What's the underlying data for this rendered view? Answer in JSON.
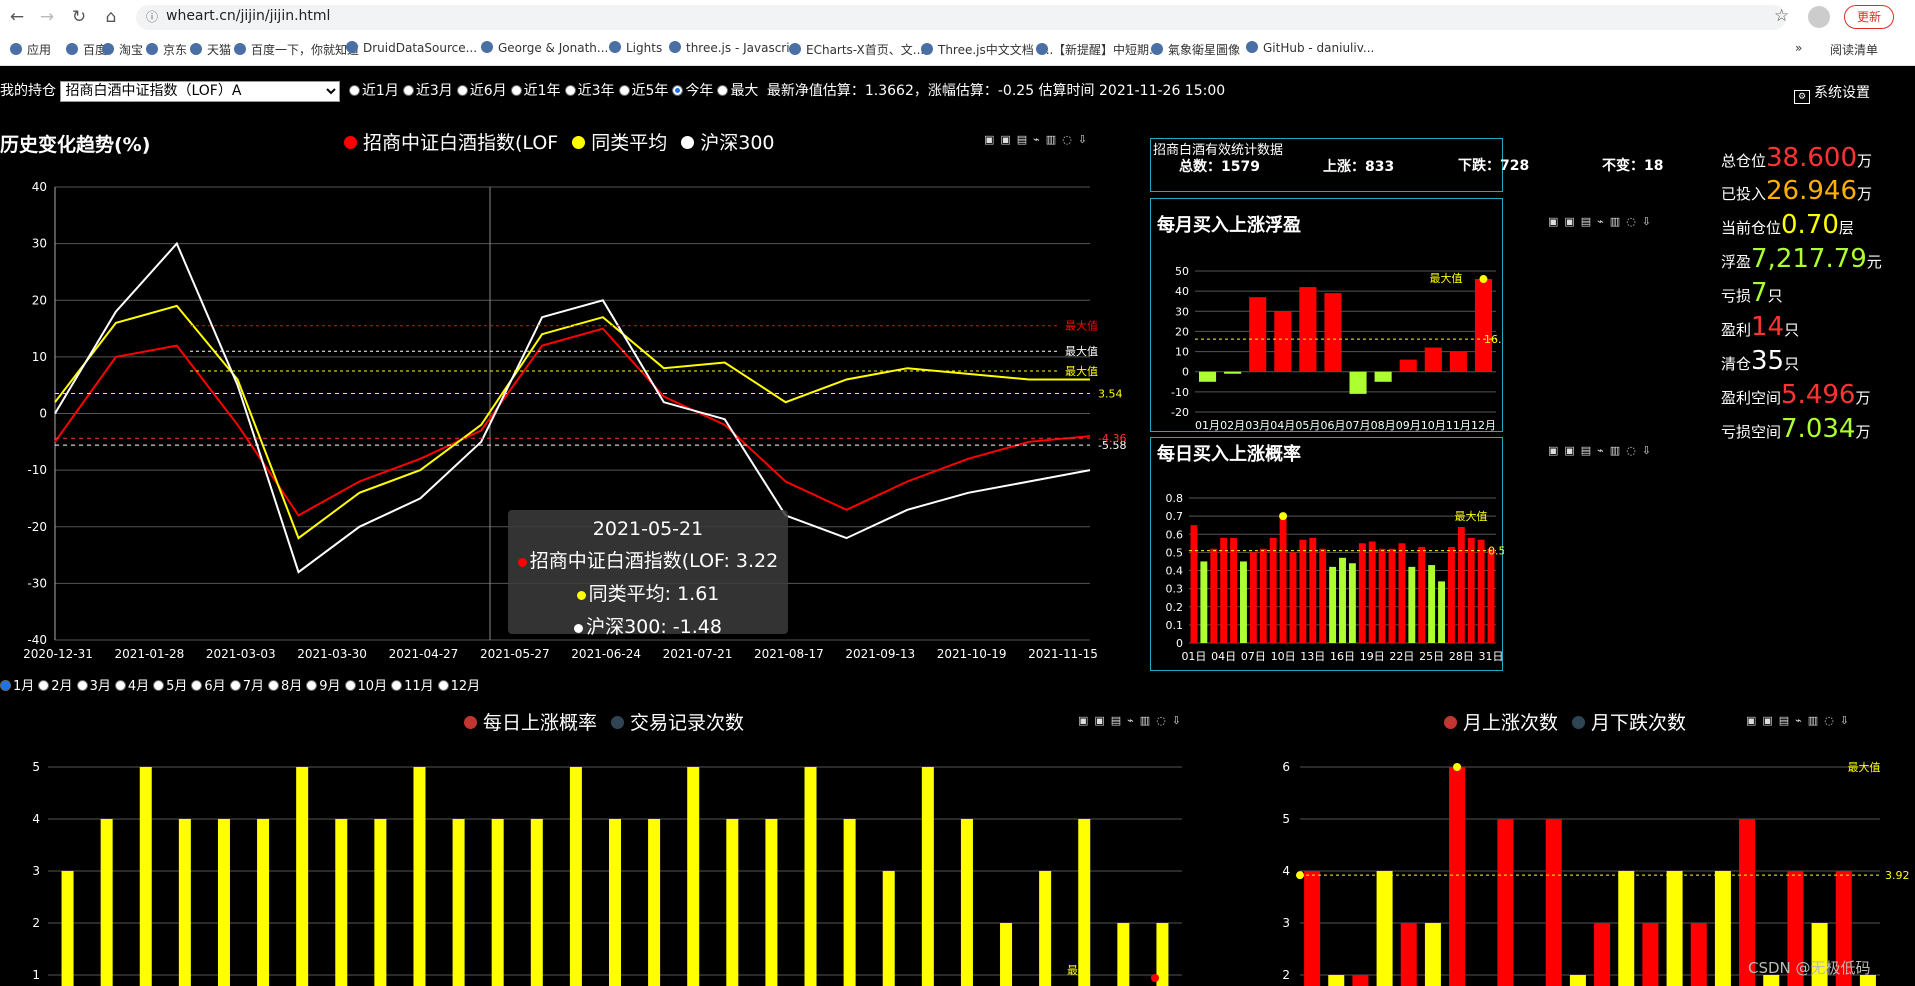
{
  "browser": {
    "url": "wheart.cn/jijin/jijin.html",
    "update_label": "更新",
    "bookmarks": [
      "应用",
      "百度",
      "淘宝",
      "京东",
      "天猫",
      "百度一下，你就知道",
      "DruidDataSource...",
      "George & Jonath...",
      "Lights",
      "three.js - Javascri...",
      "ECharts-X首页、文...",
      "Three.js中文文档 -...",
      "【新提醒】中短期...",
      "氣象衛星圖像",
      "GitHub - daniuliv..."
    ],
    "more": "»",
    "reading_list": "阅读清单"
  },
  "topbar": {
    "label": "我的持仓",
    "fund": "招商白酒中证指数（LOF）A",
    "ranges": [
      "近1月",
      "近3月",
      "近6月",
      "近1年",
      "近3年",
      "近5年",
      "今年",
      "最大"
    ],
    "selected": 6,
    "estimate": "最新净值估算：1.3662，涨幅估算：-0.25 估算时间 2021-11-26 15:00",
    "settings": "系统设置"
  },
  "trend": {
    "title": "历史变化趋势(%)",
    "legend": [
      {
        "name": "招商中证白酒指数(LOF",
        "color": "#ff0000"
      },
      {
        "name": "同类平均",
        "color": "#ffff00"
      },
      {
        "name": "沪深300",
        "color": "#ffffff"
      }
    ],
    "tooltip": {
      "date": "2021-05-21",
      "l1": "招商中证白酒指数(LOF: 3.22",
      "l2": "同类平均: 1.61",
      "l3": "沪深300: -1.48"
    },
    "marks": {
      "max": "最大值",
      "max2": "最大值",
      "max3": "最大值",
      "v1": "3.54",
      "v2": "-5.58",
      "v3": "-4.36"
    }
  },
  "chart_data": [
    {
      "type": "line",
      "title": "历史变化趋势(%)",
      "ylim": [
        -40,
        40
      ],
      "x": [
        "2020-12-31",
        "2021-01-28",
        "2021-03-03",
        "2021-03-30",
        "2021-04-27",
        "2021-05-27",
        "2021-06-24",
        "2021-07-21",
        "2021-08-17",
        "2021-09-13",
        "2021-10-19",
        "2021-11-15"
      ],
      "series": [
        {
          "name": "招商中证白酒指数(LOF",
          "values": [
            -5,
            10,
            12,
            -2,
            -18,
            -12,
            -8,
            -3,
            12,
            15,
            3,
            -2,
            -12,
            -17,
            -12,
            -8,
            -5,
            -4
          ]
        },
        {
          "name": "同类平均",
          "values": [
            2,
            16,
            19,
            6,
            -22,
            -14,
            -10,
            -2,
            14,
            17,
            8,
            9,
            2,
            6,
            8,
            7,
            6,
            6
          ]
        },
        {
          "name": "沪深300",
          "values": [
            0,
            18,
            30,
            5,
            -28,
            -20,
            -15,
            -5,
            17,
            20,
            2,
            -1,
            -18,
            -22,
            -17,
            -14,
            -12,
            -10
          ]
        }
      ]
    },
    {
      "type": "bar",
      "title": "每月买入上涨浮盈",
      "categories": [
        "01月",
        "02月",
        "03月",
        "04月",
        "05月",
        "06月",
        "07月",
        "08月",
        "09月",
        "10月",
        "11月",
        "12月"
      ],
      "values": [
        -5,
        -1,
        37,
        30,
        42,
        39,
        -11,
        -5,
        6,
        12,
        10,
        46
      ],
      "ylim": [
        -20,
        50
      ]
    },
    {
      "type": "bar",
      "title": "每日买入上涨概率",
      "categories": [
        "01日",
        "04日",
        "07日",
        "10日",
        "13日",
        "16日",
        "19日",
        "22日",
        "25日",
        "28日",
        "31日"
      ],
      "values": [
        0.65,
        0.45,
        0.52,
        0.58,
        0.58,
        0.45,
        0.5,
        0.52,
        0.58,
        0.7,
        0.5,
        0.57,
        0.58,
        0.52,
        0.42,
        0.47,
        0.44,
        0.55,
        0.56,
        0.52,
        0.52,
        0.55,
        0.42,
        0.53,
        0.43,
        0.34,
        0.53,
        0.64,
        0.58,
        0.57,
        0.52
      ],
      "ylim": [
        0,
        0.8
      ]
    },
    {
      "type": "bar",
      "title": "每日上涨概率",
      "series": [
        {
          "name": "每日上涨概率"
        },
        {
          "name": "交易记录次数"
        }
      ],
      "values": [
        3,
        4,
        5,
        4,
        4,
        4,
        5,
        4,
        4,
        5,
        4,
        4,
        4,
        5,
        4,
        4,
        5,
        4,
        4,
        5,
        4,
        3,
        5,
        4,
        2,
        3,
        4,
        2,
        2
      ],
      "ylim": [
        1,
        5
      ]
    },
    {
      "type": "bar",
      "title": "月上涨次数",
      "series": [
        {
          "name": "月上涨次数"
        },
        {
          "name": "月下跌次数"
        }
      ],
      "values": [
        4,
        2,
        2,
        4,
        3,
        3,
        6,
        1,
        5,
        1,
        5,
        2,
        3,
        4,
        3,
        4,
        3,
        4,
        5,
        2,
        4,
        3,
        4,
        2
      ],
      "ylim": [
        1,
        6
      ]
    }
  ],
  "monthly_stats": {
    "box_title": "招商白酒有效统计数据",
    "total": "总数：1579",
    "up": "上涨：833",
    "down": "下跌：728",
    "flat": "不变：18",
    "title": "每月买入上涨浮盈",
    "max_label": "最大值",
    "value_label": "16."
  },
  "daily_prob": {
    "title": "每日买入上涨概率",
    "max_label": "最大值",
    "value_label": "0.5"
  },
  "bottom_left": {
    "legend": [
      {
        "name": "每日上涨概率",
        "color": "#c23531"
      },
      {
        "name": "交易记录次数",
        "color": "#2f4554"
      }
    ],
    "max_label": "最大"
  },
  "bottom_right": {
    "legend": [
      {
        "name": "月上涨次数",
        "color": "#c23531"
      },
      {
        "name": "月下跌次数",
        "color": "#2f4554"
      }
    ],
    "max_label": "最大值",
    "value_label": "3.92"
  },
  "months": [
    "1月",
    "2月",
    "3月",
    "4月",
    "5月",
    "6月",
    "7月",
    "8月",
    "9月",
    "10月",
    "11月",
    "12月"
  ],
  "stats": [
    {
      "label": "总仓位",
      "value": "38.600",
      "unit": "万",
      "color": "#ff3333"
    },
    {
      "label": "已投入",
      "value": "26.946",
      "unit": "万",
      "color": "#ffb000"
    },
    {
      "label": "当前仓位",
      "value": "0.70",
      "unit": "层",
      "color": "#ffff00"
    },
    {
      "label": "浮盈",
      "value": "7,217.79",
      "unit": "元",
      "color": "#adff2f"
    },
    {
      "label": "亏损",
      "value": "7",
      "unit": "只",
      "color": "#adff2f"
    },
    {
      "label": "盈利",
      "value": "14",
      "unit": "只",
      "color": "#ff3333"
    },
    {
      "label": "清仓",
      "value": "35",
      "unit": "只",
      "color": "#ffffff"
    },
    {
      "label": "盈利空间",
      "value": "5.496",
      "unit": "万",
      "color": "#ff3333"
    },
    {
      "label": "亏损空间",
      "value": "7.034",
      "unit": "万",
      "color": "#adff2f"
    }
  ],
  "watermark": "CSDN @无极低码"
}
